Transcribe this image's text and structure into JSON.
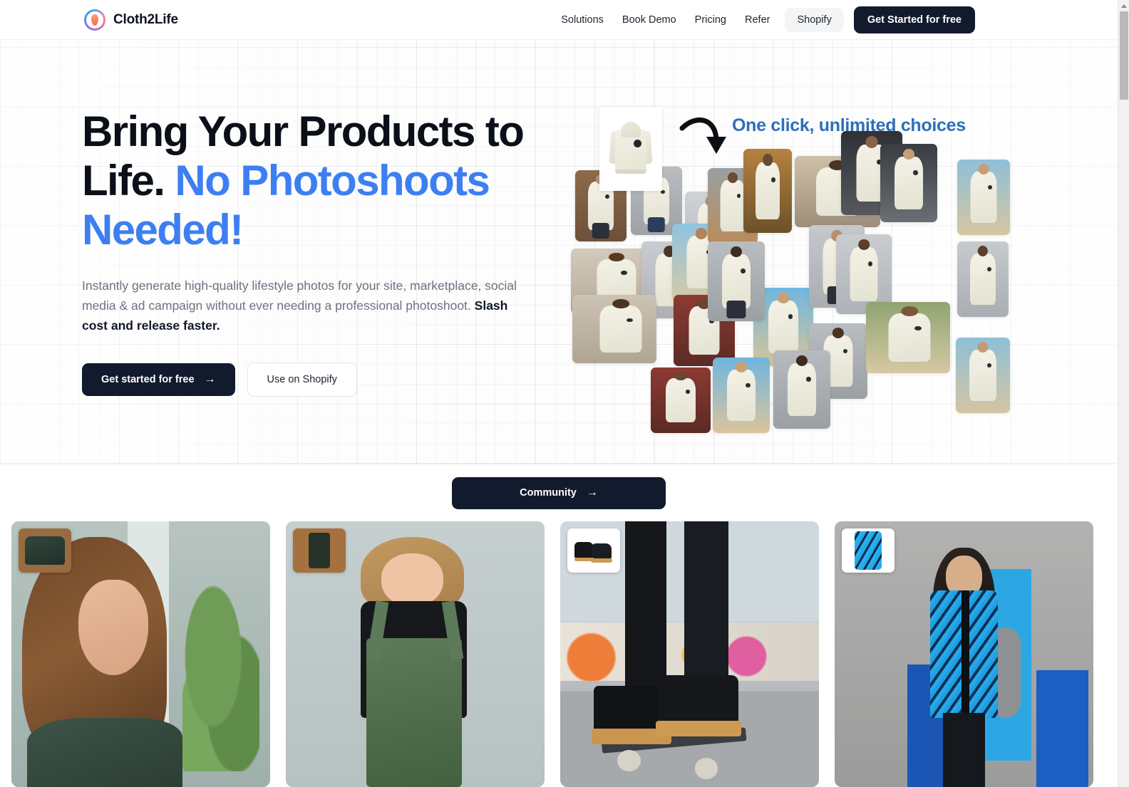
{
  "brand": {
    "name": "Cloth2Life",
    "logo_icon": "cloth2life-logo-icon"
  },
  "nav": {
    "links": [
      {
        "label": "Solutions"
      },
      {
        "label": "Book Demo"
      },
      {
        "label": "Pricing"
      },
      {
        "label": "Refer"
      }
    ],
    "chip": "Shopify",
    "cta": "Get Started for free"
  },
  "hero": {
    "headline_line1": "Bring Your Products to",
    "headline_line2_dark": "Life.",
    "headline_line2_accent": "No Photoshoots",
    "headline_line3_accent": "Needed!",
    "sub_normal": "Instantly generate high-quality lifestyle photos for your site, marketplace, social media & ad campaign without ever needing a professional photoshoot.",
    "sub_bold": "Slash cost and release faster.",
    "primary_cta": "Get started for free",
    "primary_cta_icon": "arrow-right-icon",
    "secondary_cta": "Use on Shopify",
    "tagline": "One click, unlimited choices",
    "arrow_icon": "curved-arrow-down-icon",
    "product_thumb_name": "cream-hoodie-product-image",
    "accent_color": "#3d7ff2",
    "tagline_color": "#2e6fb7",
    "dark_color": "#121a2e"
  },
  "community": {
    "label": "Community",
    "icon": "arrow-right-icon"
  },
  "gallery": {
    "cards": [
      {
        "name": "gallery-card-green-sweater",
        "thumb": "green-knit-sweater-thumbnail",
        "scene": "woman-wearing-green-cable-knit-sweater"
      },
      {
        "name": "gallery-card-green-overalls",
        "thumb": "green-overalls-thumbnail",
        "scene": "toddler-wearing-green-knit-overalls"
      },
      {
        "name": "gallery-card-black-sneakers",
        "thumb": "black-high-top-sneakers-thumbnail",
        "scene": "skateboarder-wearing-black-high-top-sneakers"
      },
      {
        "name": "gallery-card-blue-print-shirt",
        "thumb": "blue-floral-print-shirt-thumbnail",
        "scene": "woman-wearing-blue-floral-print-shirt"
      }
    ]
  },
  "scrollbar": {
    "name": "vertical-scrollbar"
  }
}
